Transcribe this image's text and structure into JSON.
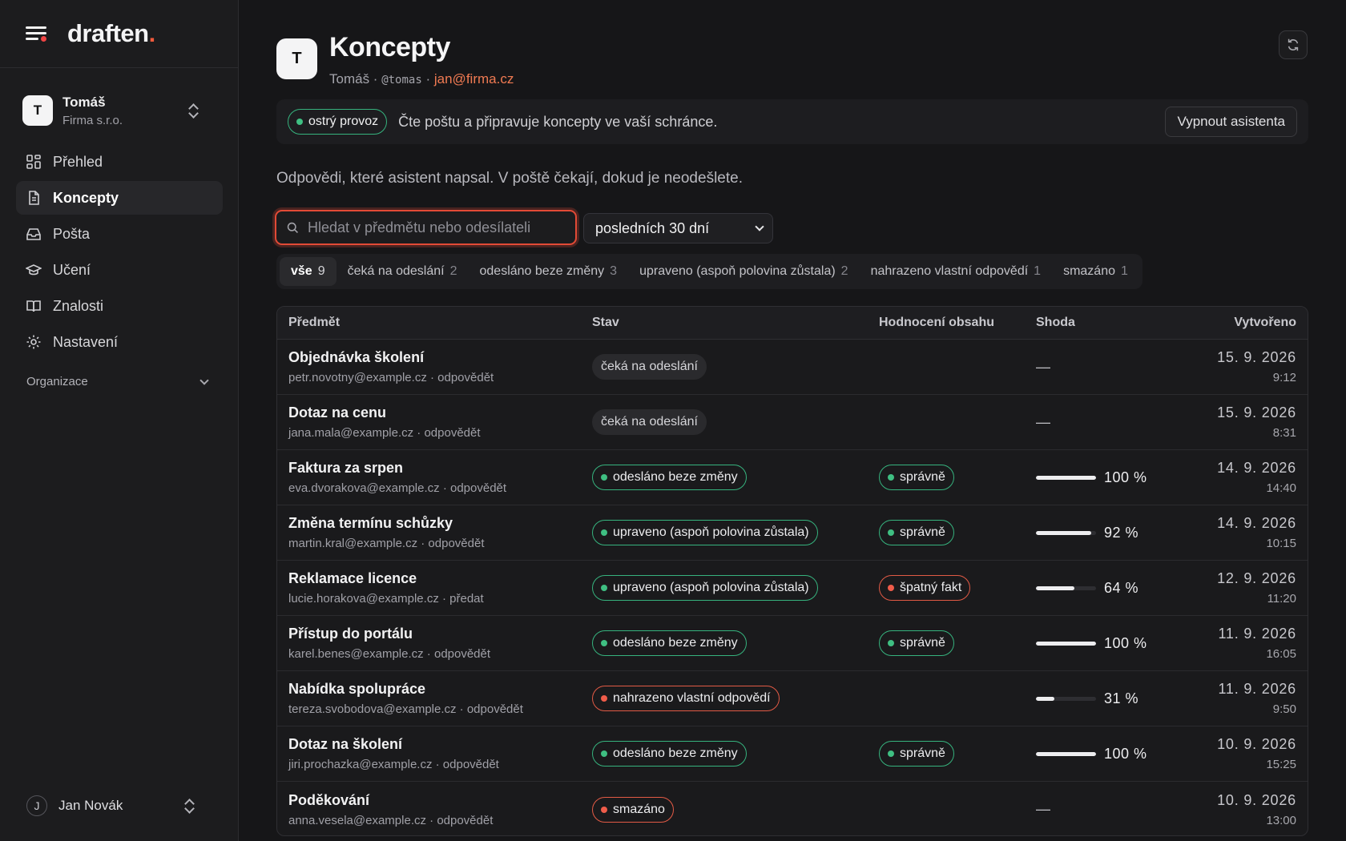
{
  "brand": {
    "name": "draften",
    "dot": "."
  },
  "account": {
    "initial": "T",
    "name": "Tomáš",
    "org": "Firma s.r.o."
  },
  "nav": [
    {
      "label": "Přehled",
      "icon": "dashboard-icon",
      "active": false
    },
    {
      "label": "Koncepty",
      "icon": "document-icon",
      "active": true
    },
    {
      "label": "Pošta",
      "icon": "inbox-icon",
      "active": false
    },
    {
      "label": "Učení",
      "icon": "graduation-cap-icon",
      "active": false
    },
    {
      "label": "Znalosti",
      "icon": "book-icon",
      "active": false
    },
    {
      "label": "Nastavení",
      "icon": "gear-icon",
      "active": false
    }
  ],
  "org_section": {
    "label": "Organizace"
  },
  "user": {
    "initial": "J",
    "name": "Jan Novák"
  },
  "page": {
    "avatar": "T",
    "title": "Koncepty",
    "sub_name": "Tomáš",
    "sep": " · ",
    "handle": "@tomas",
    "email": "jan@firma.cz"
  },
  "banner": {
    "status": "ostrý provoz",
    "text": "Čte poštu a připravuje koncepty ve vaší schránce.",
    "button": "Vypnout asistenta"
  },
  "intro": "Odpovědi, které asistent napsal. V poště čekají, dokud je neodešlete.",
  "search": {
    "placeholder": "Hledat v předmětu nebo odesílateli",
    "value": ""
  },
  "range": {
    "selected": "posledních 30 dní"
  },
  "filters": [
    {
      "label": "vše",
      "count": "9",
      "active": true
    },
    {
      "label": "čeká na odeslání",
      "count": "2",
      "active": false
    },
    {
      "label": "odesláno beze změny",
      "count": "3",
      "active": false
    },
    {
      "label": "upraveno (aspoň polovina zůstala)",
      "count": "2",
      "active": false
    },
    {
      "label": "nahrazeno vlastní odpovědí",
      "count": "1",
      "active": false
    },
    {
      "label": "smazáno",
      "count": "1",
      "active": false
    }
  ],
  "table": {
    "headers": {
      "subject": "Předmět",
      "status": "Stav",
      "eval": "Hodnocení obsahu",
      "match": "Shoda",
      "created": "Vytvořeno"
    },
    "rows": [
      {
        "subject": "Objednávka školení",
        "meta": "petr.novotny@example.cz · odpovědět",
        "status": "čeká na odeslání",
        "status_kind": "neutral",
        "eval": "",
        "eval_kind": "",
        "match": null,
        "match_label": "—",
        "date": "15. 9. 2026",
        "time": "9:12"
      },
      {
        "subject": "Dotaz na cenu",
        "meta": "jana.mala@example.cz · odpovědět",
        "status": "čeká na odeslání",
        "status_kind": "neutral",
        "eval": "",
        "eval_kind": "",
        "match": null,
        "match_label": "—",
        "date": "15. 9. 2026",
        "time": "8:31"
      },
      {
        "subject": "Faktura za srpen",
        "meta": "eva.dvorakova@example.cz · odpovědět",
        "status": "odesláno beze změny",
        "status_kind": "green",
        "eval": "správně",
        "eval_kind": "green",
        "match": 100,
        "match_label": "100 %",
        "date": "14. 9. 2026",
        "time": "14:40"
      },
      {
        "subject": "Změna termínu schůzky",
        "meta": "martin.kral@example.cz · odpovědět",
        "status": "upraveno (aspoň polovina zůstala)",
        "status_kind": "green",
        "eval": "správně",
        "eval_kind": "green",
        "match": 92,
        "match_label": "92 %",
        "date": "14. 9. 2026",
        "time": "10:15"
      },
      {
        "subject": "Reklamace licence",
        "meta": "lucie.horakova@example.cz · předat",
        "status": "upraveno (aspoň polovina zůstala)",
        "status_kind": "green",
        "eval": "špatný fakt",
        "eval_kind": "red",
        "match": 64,
        "match_label": "64 %",
        "date": "12. 9. 2026",
        "time": "11:20"
      },
      {
        "subject": "Přístup do portálu",
        "meta": "karel.benes@example.cz · odpovědět",
        "status": "odesláno beze změny",
        "status_kind": "green",
        "eval": "správně",
        "eval_kind": "green",
        "match": 100,
        "match_label": "100 %",
        "date": "11. 9. 2026",
        "time": "16:05"
      },
      {
        "subject": "Nabídka spolupráce",
        "meta": "tereza.svobodova@example.cz · odpovědět",
        "status": "nahrazeno vlastní odpovědí",
        "status_kind": "red",
        "eval": "",
        "eval_kind": "",
        "match": 31,
        "match_label": "31 %",
        "date": "11. 9. 2026",
        "time": "9:50"
      },
      {
        "subject": "Dotaz na školení",
        "meta": "jiri.prochazka@example.cz · odpovědět",
        "status": "odesláno beze změny",
        "status_kind": "green",
        "eval": "správně",
        "eval_kind": "green",
        "match": 100,
        "match_label": "100 %",
        "date": "10. 9. 2026",
        "time": "15:25"
      },
      {
        "subject": "Poděkování",
        "meta": "anna.vesela@example.cz · odpovědět",
        "status": "smazáno",
        "status_kind": "red",
        "eval": "",
        "eval_kind": "",
        "match": null,
        "match_label": "—",
        "date": "10. 9. 2026",
        "time": "13:00"
      }
    ]
  },
  "colors": {
    "accent": "#e24a36",
    "email": "#f07a52",
    "green": "#36b37e",
    "red": "#e25a45",
    "background": "#161618",
    "sidebar": "#1c1c1e"
  }
}
